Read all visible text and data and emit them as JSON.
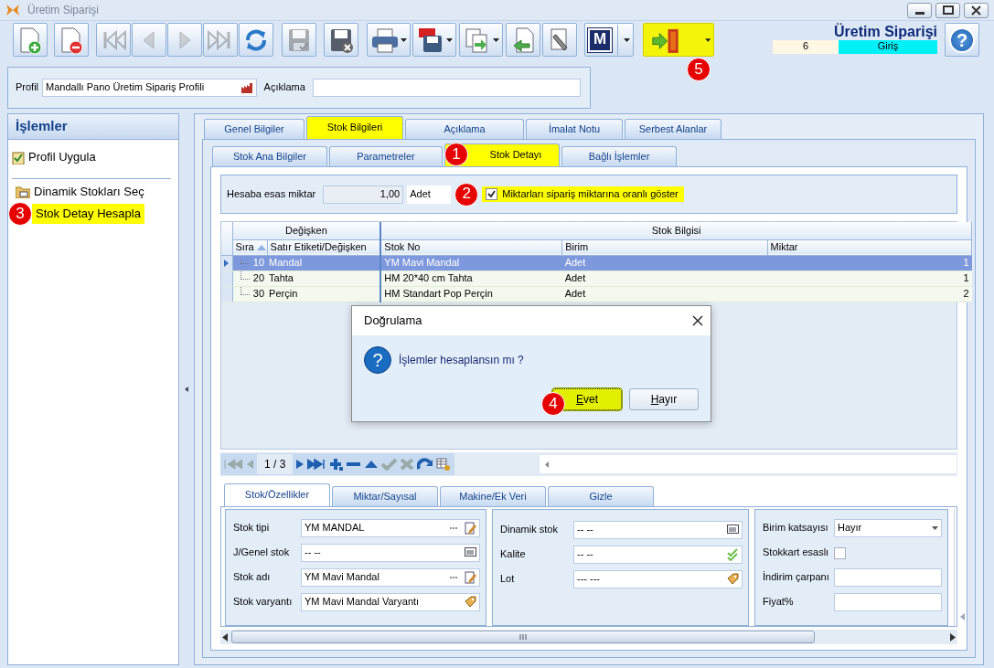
{
  "window": {
    "title": "Üretim Siparişi"
  },
  "toolbar": [
    {
      "kind": "new",
      "disabled": false
    },
    {
      "kind": "delete",
      "disabled": false
    },
    {
      "kind": "first",
      "disabled": true
    },
    {
      "kind": "prev",
      "disabled": true
    },
    {
      "kind": "next",
      "disabled": true
    },
    {
      "kind": "last",
      "disabled": true
    },
    {
      "kind": "refresh",
      "disabled": false
    },
    {
      "kind": "save",
      "disabled": true
    },
    {
      "kind": "discard",
      "disabled": false
    },
    {
      "kind": "print",
      "disabled": false
    },
    {
      "kind": "pdf",
      "disabled": false
    },
    {
      "kind": "copy",
      "disabled": false
    },
    {
      "kind": "back",
      "disabled": false
    },
    {
      "kind": "tools",
      "disabled": false
    },
    {
      "kind": "menu",
      "disabled": false,
      "label": "M"
    },
    {
      "kind": "exit",
      "disabled": false,
      "highlighted": true,
      "callout": "5"
    }
  ],
  "header": {
    "title": "Üretim Siparişi",
    "number": "6",
    "mode": "Giriş",
    "help": "?"
  },
  "profile": {
    "label": "Profil",
    "value": "Mandallı Pano Üretim Sipariş Profili",
    "description_label": "Açıklama"
  },
  "sidebar": {
    "title": "İşlemler",
    "items": [
      {
        "label": "Profil Uygula",
        "kind": "apply",
        "highlighted": false
      },
      {
        "label": "Dinamik Stokları Seç",
        "kind": "folder",
        "highlighted": false
      },
      {
        "label": "Stok Detay Hesapla",
        "kind": "none",
        "highlighted": true,
        "callout": "3"
      }
    ]
  },
  "tabs": [
    {
      "label": "Genel Bilgiler",
      "selected": false,
      "highlighted": false
    },
    {
      "label": "Stok Bilgileri",
      "selected": true,
      "highlighted": true
    },
    {
      "label": "Açıklama",
      "selected": false,
      "highlighted": false
    },
    {
      "label": "İmalat Notu",
      "selected": false,
      "highlighted": false
    },
    {
      "label": "Serbest Alanlar",
      "selected": false,
      "highlighted": false
    }
  ],
  "subtabs": [
    {
      "label": "Stok Ana Bilgiler",
      "selected": false,
      "highlighted": false
    },
    {
      "label": "Parametreler",
      "selected": false,
      "highlighted": false
    },
    {
      "label": "Stok Detayı",
      "selected": true,
      "highlighted": true,
      "callout": "1"
    },
    {
      "label": "Bağlı İşlemler",
      "selected": false,
      "highlighted": false
    }
  ],
  "quantity": {
    "label": "Hesaba esas miktar",
    "value": "1,00",
    "unit": "Adet",
    "callout": "2",
    "checkbox": {
      "label": "Miktarları sipariş miktarına oranlı göster",
      "checked": true,
      "highlighted": true
    }
  },
  "grid": {
    "bands": [
      "Değişken",
      "Stok Bilgisi"
    ],
    "columns": [
      "Sıra",
      "Satır Etiketi/Değişken",
      "Stok No",
      "Birim",
      "Miktar"
    ],
    "rows": [
      {
        "order": "10",
        "label": "Mandal",
        "stock_no": "YM Mavi Mandal",
        "unit": "Adet",
        "quantity": "1",
        "selected": true
      },
      {
        "order": "20",
        "label": "Tahta",
        "stock_no": "HM 20*40 cm Tahta",
        "unit": "Adet",
        "quantity": "1",
        "selected": false
      },
      {
        "order": "30",
        "label": "Perçin",
        "stock_no": "HM Standart Pop Perçin",
        "unit": "Adet",
        "quantity": "2",
        "selected": false
      }
    ],
    "position": "1 / 3"
  },
  "dialog": {
    "title": "Doğrulama",
    "icon": "?",
    "message": "İşlemler hesaplansın mı ?",
    "buttons": [
      {
        "label": "Evet",
        "highlighted": true,
        "callout": "4"
      },
      {
        "label": "Hayır",
        "highlighted": false
      }
    ]
  },
  "bottom_tabs": [
    {
      "label": "Stok/Özellikler",
      "selected": true
    },
    {
      "label": "Miktar/Sayısal",
      "selected": false
    },
    {
      "label": "Makine/Ek Veri",
      "selected": false
    },
    {
      "label": "Gizle",
      "selected": false
    }
  ],
  "panels": [
    {
      "fields": [
        {
          "label": "Stok tipi",
          "value": "YM MANDAL",
          "kind": "edit"
        },
        {
          "label": "J/Genel stok",
          "value": "-- --",
          "kind": "list"
        },
        {
          "label": "Stok adı",
          "value": "YM Mavi Mandal",
          "kind": "edit"
        },
        {
          "label": "Stok varyantı",
          "value": "YM Mavi Mandal Varyantı",
          "kind": "tag"
        }
      ]
    },
    {
      "fields": [
        {
          "label": "Dinamik stok",
          "value": "-- --",
          "kind": "list"
        },
        {
          "label": "Kalite",
          "value": "-- --",
          "kind": "check"
        },
        {
          "label": "Lot",
          "value": "--- ---",
          "kind": "tag"
        }
      ]
    },
    {
      "fields": [
        {
          "label": "Birim katsayısı",
          "value": "Hayır",
          "kind": "select"
        },
        {
          "label": "Stokkart esaslı",
          "kind": "checkbox",
          "checked": false
        },
        {
          "label": "İndirim çarpanı",
          "kind": "text"
        },
        {
          "label": "Fiyat%",
          "kind": "text"
        }
      ]
    }
  ]
}
